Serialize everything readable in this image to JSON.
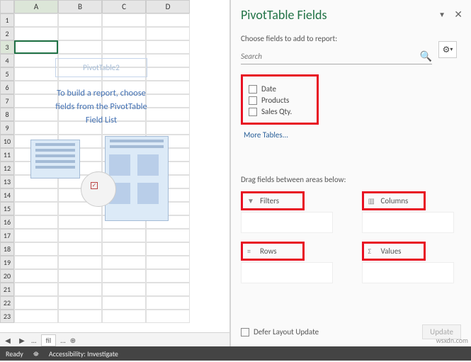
{
  "grid": {
    "columns": [
      "A",
      "B",
      "C",
      "D"
    ],
    "rows": [
      1,
      2,
      3,
      4,
      5,
      6,
      7,
      8,
      9,
      10,
      11,
      12,
      13,
      14,
      15,
      16,
      17,
      18,
      19,
      20,
      21,
      22,
      23
    ],
    "active_cell": "A3"
  },
  "pivot_placeholder": {
    "title": "PivotTable2",
    "line1": "To build a report, choose",
    "line2": "fields from the PivotTable",
    "line3": "Field List"
  },
  "sheet_tabs": {
    "prev": "...",
    "next": "...",
    "center": "fil",
    "ellipsis": "..."
  },
  "status_bar": {
    "ready": "Ready",
    "access": "Accessibility: Investigate"
  },
  "pane": {
    "title": "PivotTable Fields",
    "subtitle": "Choose fields to add to report:",
    "search_placeholder": "Search",
    "fields": [
      "Date",
      "Products",
      "Sales Qty."
    ],
    "more_tables": "More Tables...",
    "drag_label": "Drag fields between areas below:",
    "areas": {
      "filters": "Filters",
      "columns": "Columns",
      "rows": "Rows",
      "values": "Values"
    },
    "defer": "Defer Layout Update",
    "update_btn": "Update"
  },
  "watermark": "wsxdn.com"
}
